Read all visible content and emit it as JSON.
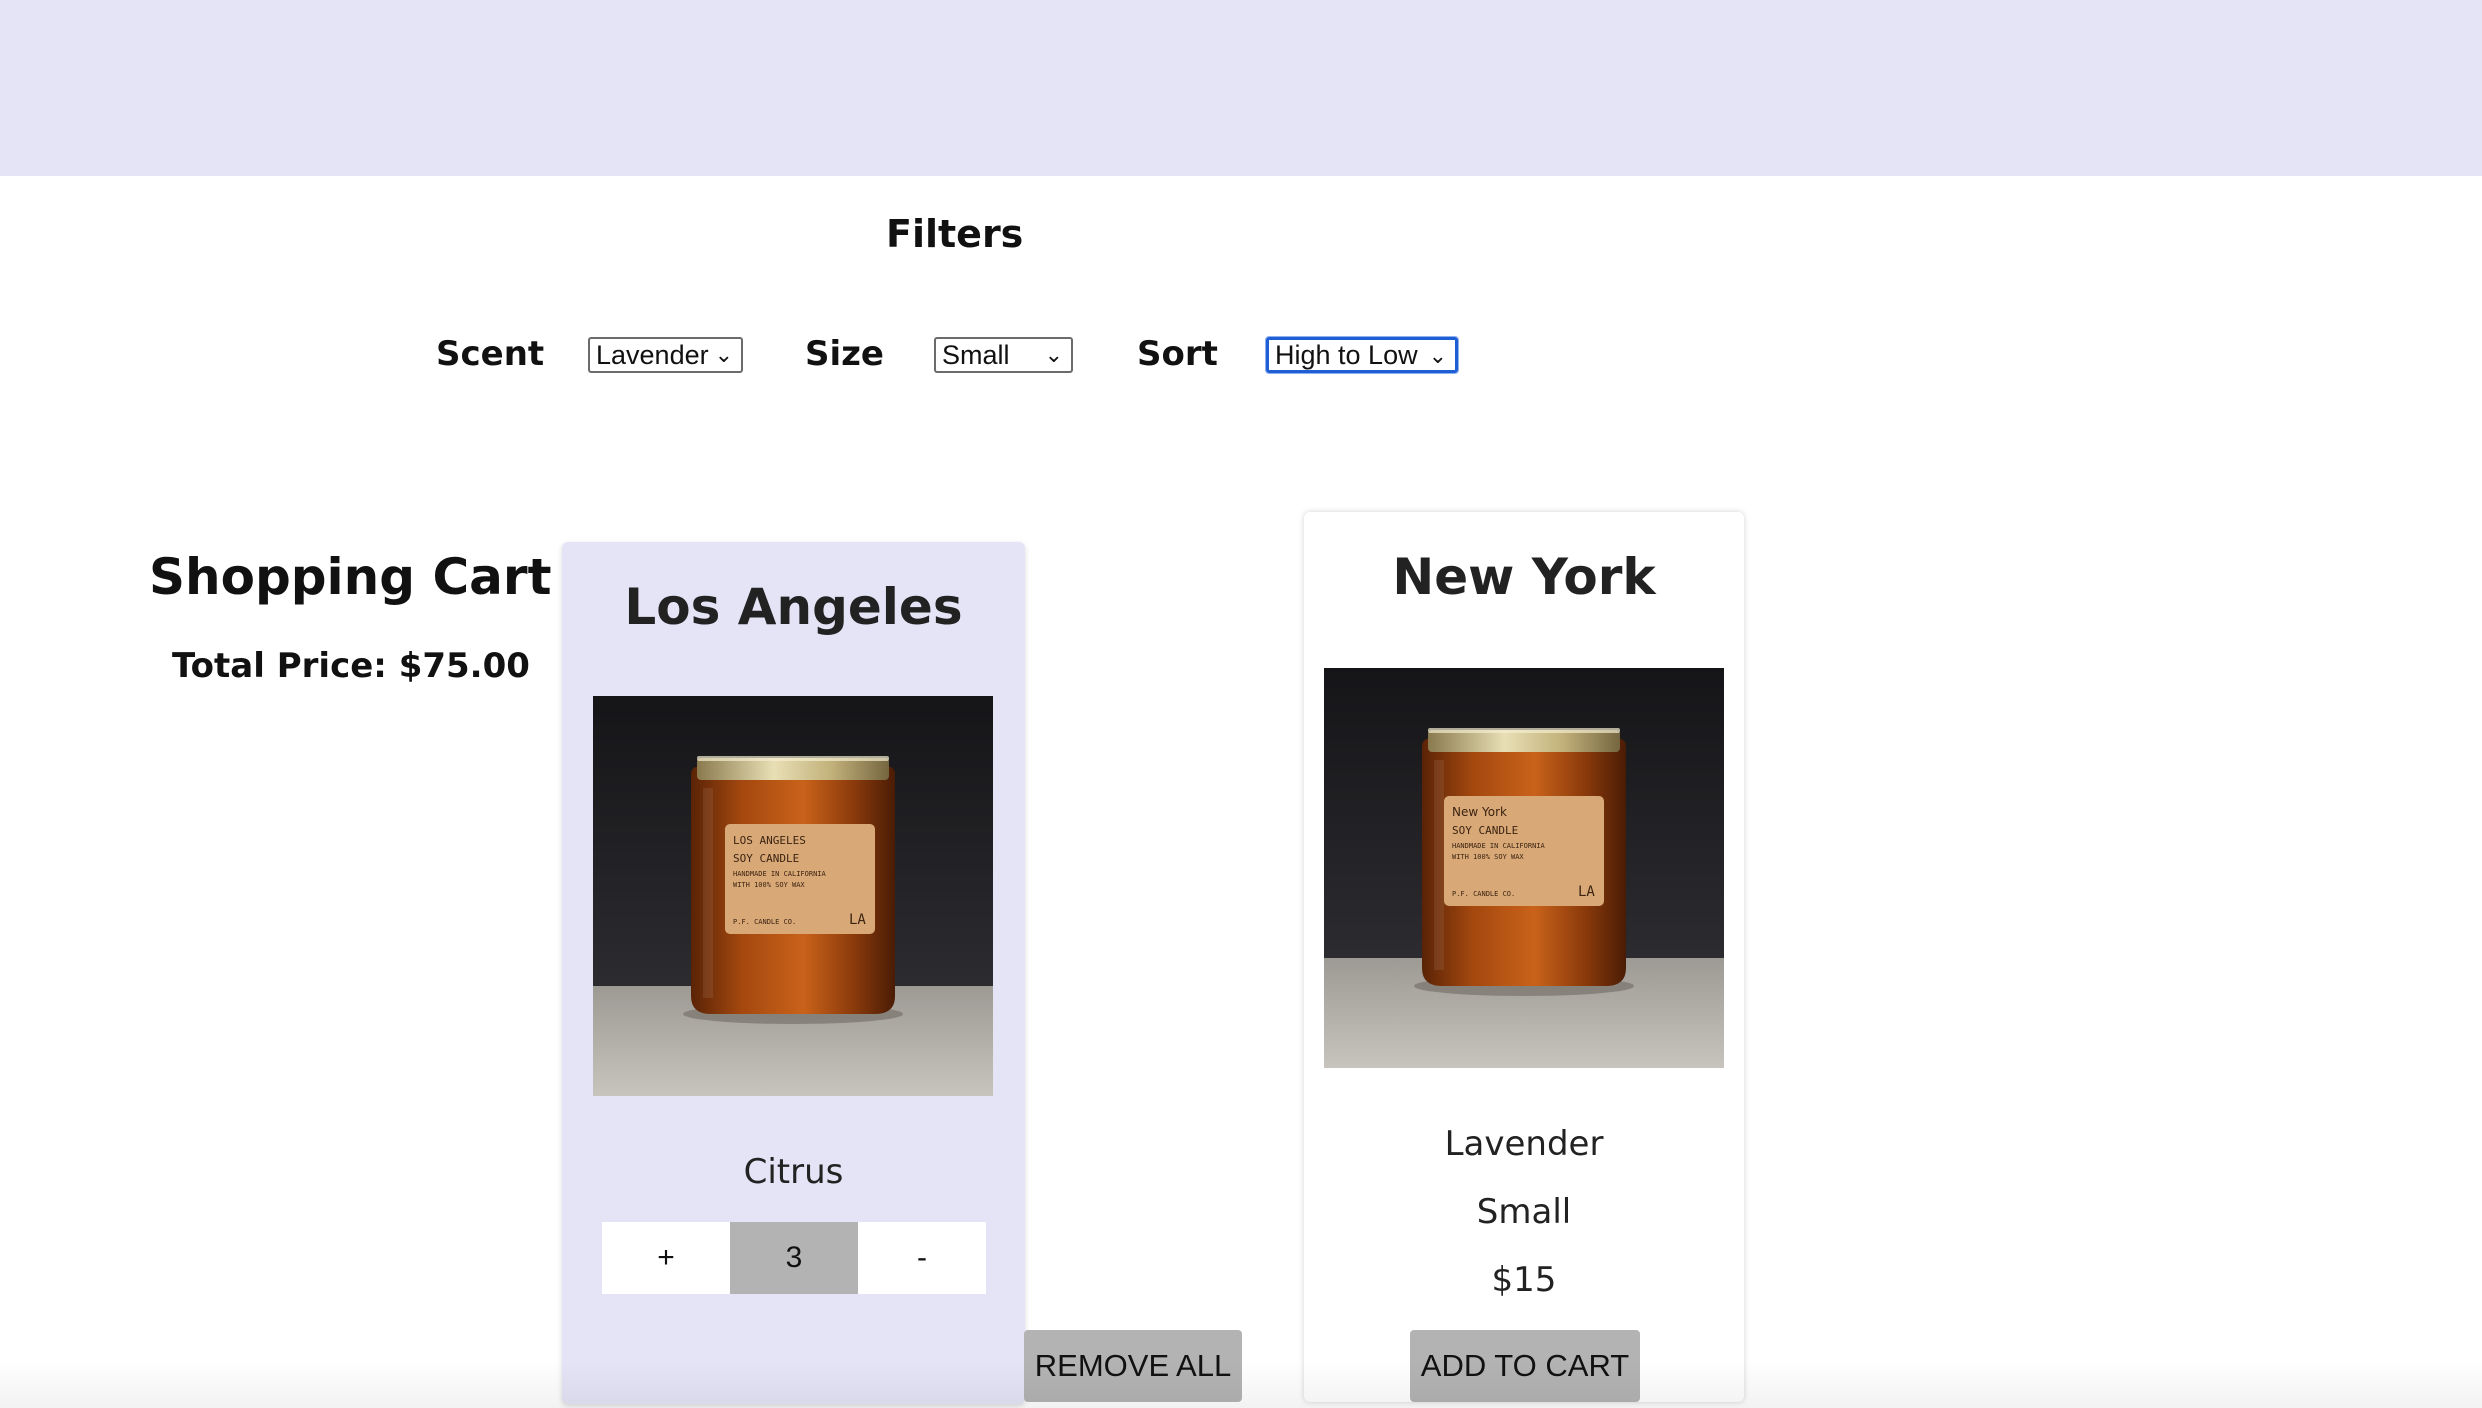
{
  "filters": {
    "title": "Filters",
    "scent_label": "Scent",
    "scent_value": "Lavender",
    "size_label": "Size",
    "size_value": "Small",
    "sort_label": "Sort",
    "sort_value": "High to Low"
  },
  "cart": {
    "title": "Shopping Cart",
    "total": "Total Price: $75.00",
    "remove_all_label": "REMOVE ALL",
    "items": [
      {
        "name": "Los Angeles",
        "scent": "Citrus",
        "plus_label": "+",
        "quantity": "3",
        "minus_label": "-",
        "jar_label_lines": [
          "LOS ANGELES",
          "SOY CANDLE",
          "HANDMADE IN CALIFORNIA",
          "WITH 100% SOY WAX",
          "P.F. CANDLE CO."
        ],
        "jar_monogram": "LA"
      }
    ]
  },
  "products": [
    {
      "name": "New York",
      "scent": "Lavender",
      "size": "Small",
      "price": "$15",
      "add_label": "ADD TO CART",
      "jar_label_lines": [
        "New York",
        "SOY CANDLE",
        "HANDMADE IN CALIFORNIA",
        "WITH 100% SOY WAX",
        "P.F. CANDLE CO."
      ],
      "jar_monogram": "LA"
    }
  ],
  "colors": {
    "header_bg": "#e4e4f6",
    "cart_card_bg": "#e4e4f6",
    "button_gray": "#b3b3b3",
    "focus_blue": "#1f5fd6"
  }
}
